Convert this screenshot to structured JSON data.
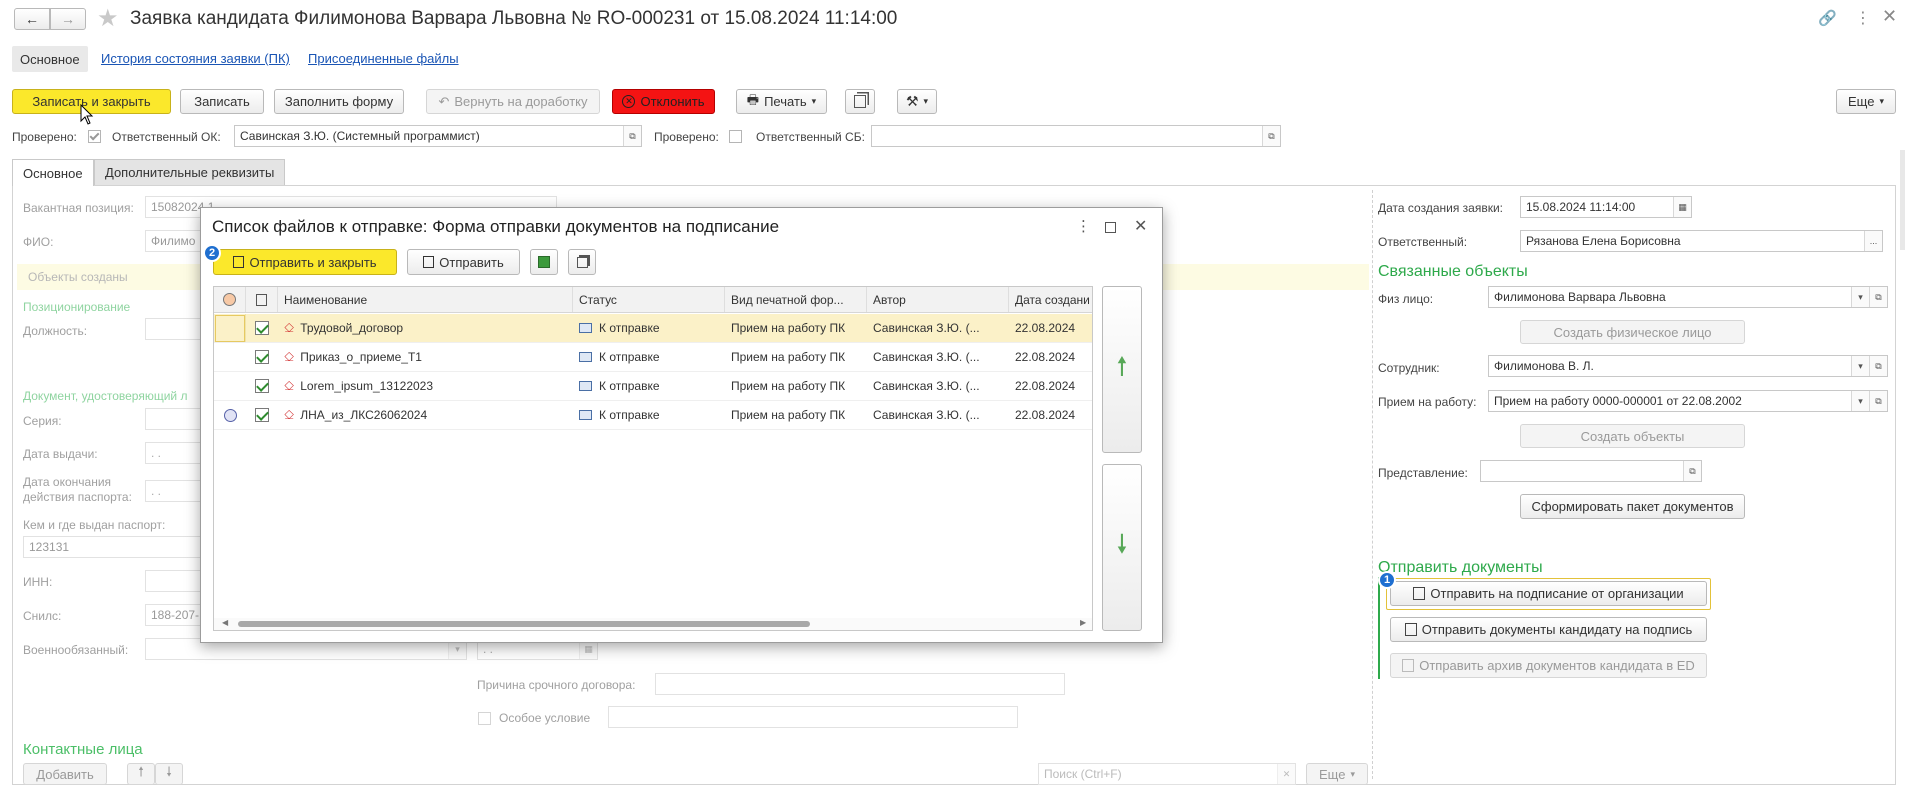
{
  "window": {
    "title": "Заявка кандидата Филимонова Варвара  Львовна № RO-000231 от 15.08.2024 11:14:00"
  },
  "nav_tabs": [
    "Основное",
    "История состояния заявки (ПК)",
    "Присоединенные файлы"
  ],
  "toolbar": {
    "save_close": "Записать и закрыть",
    "save": "Записать",
    "fill_form": "Заполнить форму",
    "return_rework": "Вернуть на доработку",
    "reject": "Отклонить",
    "print": "Печать",
    "more": "Еще"
  },
  "checks": {
    "checked1_label": "Проверено:",
    "resp_ok_label": "Ответственный ОК:",
    "resp_ok_value": "Савинская З.Ю. (Системный программист)",
    "checked2_label": "Проверено:",
    "resp_sb_label": "Ответственный СБ:",
    "resp_sb_value": ""
  },
  "form_tabs": [
    "Основное",
    "Дополнительные реквизиты"
  ],
  "left": {
    "vacancy_label": "Вакантная позиция:",
    "vacancy_value": "15082024 1",
    "fio_label": "ФИО:",
    "fio_value": "Филимо",
    "objects_created": "Объекты созданы",
    "positioning": "Позиционирование",
    "position_label": "Должность:",
    "id_doc": "Документ, удостоверяющий л",
    "series_label": "Серия:",
    "issue_date_label": "Дата выдачи:",
    "date_placeholder": ". .",
    "expiry_label_1": "Дата окончания",
    "expiry_label_2": "действия паспорта:",
    "issued_by_label": "Кем и где выдан паспорт:",
    "issued_by_value": "123131",
    "inn_label": "ИНН:",
    "snils_label": "Снилс:",
    "snils_value": "188-207-",
    "military_label": "Военнообязанный:",
    "urgent_reason_label": "Причина срочного договора:",
    "special_condition": "Особое условие",
    "contacts": "Контактные лица",
    "add_btn": "Добавить",
    "search_placeholder": "Поиск (Ctrl+F)",
    "more_btn": "Еще"
  },
  "right": {
    "created_label": "Дата создания заявки:",
    "created_value": "15.08.2024 11:14:00",
    "responsible_label": "Ответственный:",
    "responsible_value": "Рязанова Елена Борисовна",
    "linked_objects": "Связанные объекты",
    "person_label": "Физ лицо:",
    "person_value": "Филимонова Варвара Львовна",
    "create_person_btn": "Создать физическое лицо",
    "employee_label": "Сотрудник:",
    "employee_value": "Филимонова В. Л.",
    "hiring_label": "Прием на работу:",
    "hiring_value": "Прием на работу 0000-000001 от 22.08.2002",
    "create_objects_btn": "Создать объекты",
    "representation_label": "Представление:",
    "form_package_btn": "Сформировать пакет документов",
    "send_docs": "Отправить документы",
    "send_org_btn": "Отправить на подписание от организации",
    "send_candidate_btn": "Отправить документы кандидату на подпись",
    "send_archive_btn": "Отправить архив документов кандидата в ED",
    "badge": "1"
  },
  "dialog": {
    "title": "Список файлов к отправке: Форма отправки документов на подписание",
    "send_close_btn": "Отправить и закрыть",
    "send_btn": "Отправить",
    "badge": "2",
    "columns": [
      "Наименование",
      "Статус",
      "Вид печатной фор...",
      "Автор",
      "Дата создани"
    ],
    "rows": [
      {
        "name": "Трудовой_договор",
        "status": "К отправке",
        "kind": "Прием на работу ПК",
        "author": "Савинская З.Ю. (...",
        "date": "22.08.2024"
      },
      {
        "name": "Приказ_о_приеме_Т1",
        "status": "К отправке",
        "kind": "Прием на работу ПК",
        "author": "Савинская З.Ю. (...",
        "date": "22.08.2024"
      },
      {
        "name": "Lorem_ipsum_13122023",
        "status": "К отправке",
        "kind": "Прием на работу ПК",
        "author": "Савинская З.Ю. (...",
        "date": "22.08.2024"
      },
      {
        "name": "ЛНА_из_ЛКС26062024",
        "status": "К отправке",
        "kind": "Прием на работу ПК",
        "author": "Савинская З.Ю. (...",
        "date": "22.08.2024"
      }
    ]
  }
}
